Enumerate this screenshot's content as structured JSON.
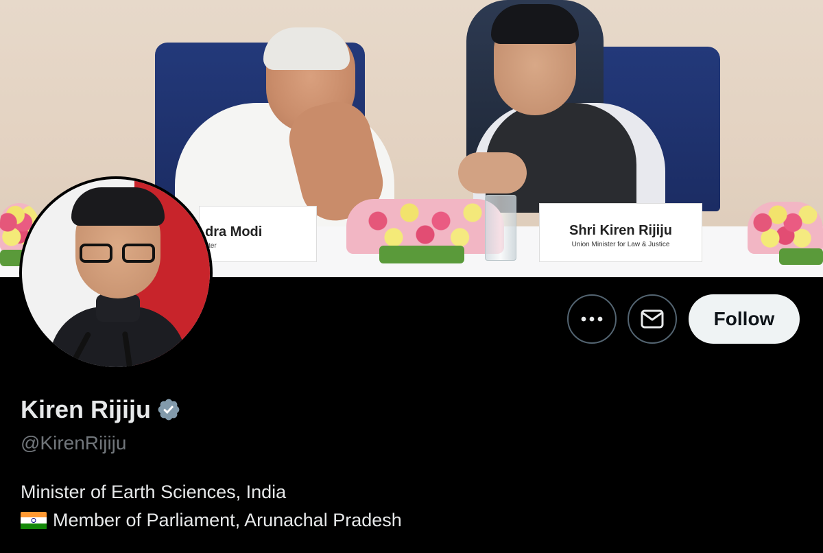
{
  "banner": {
    "nameplates": {
      "left": {
        "main": "dra Modi",
        "sub": "ster"
      },
      "right": {
        "main": "Shri Kiren Rijiju",
        "sub": "Union Minister for Law & Justice"
      }
    }
  },
  "profile": {
    "display_name": "Kiren Rijiju",
    "handle": "@KirenRijiju",
    "bio_line1": "Minister of Earth Sciences, India",
    "bio_line2": "Member of Parliament, Arunachal Pradesh",
    "verified": true
  },
  "actions": {
    "more_icon": "more-icon",
    "message_icon": "mail-icon",
    "follow_label": "Follow"
  },
  "colors": {
    "background": "#000000",
    "text_primary": "#e7e9ea",
    "text_secondary": "#71767b",
    "button_border": "#536471",
    "follow_bg": "#eff3f4",
    "verified_badge": "#829aab",
    "flag_saffron": "#ff9933",
    "flag_white": "#ffffff",
    "flag_green": "#138808"
  }
}
